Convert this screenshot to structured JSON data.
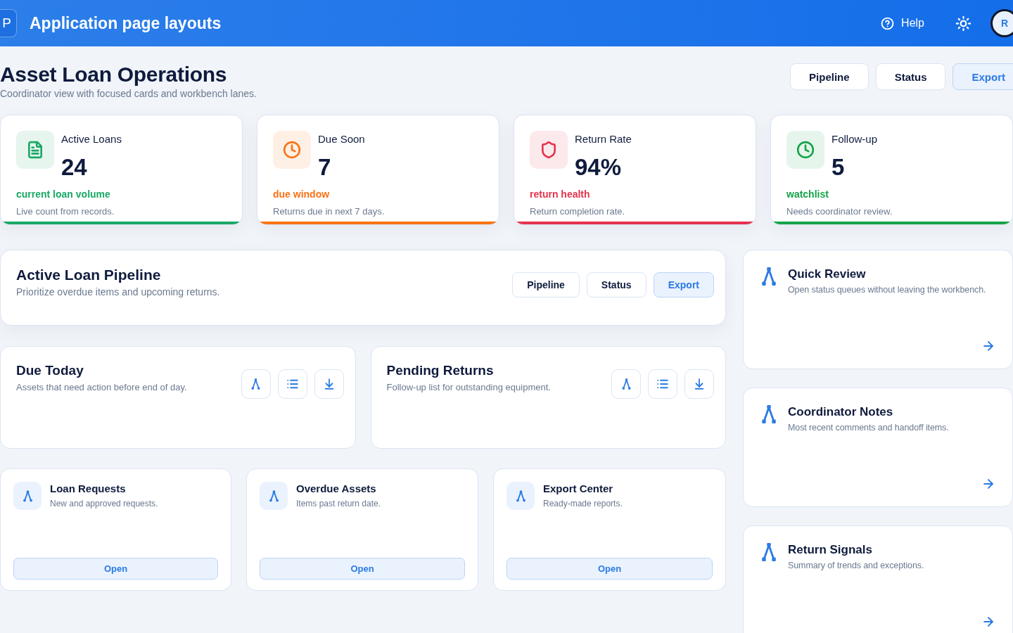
{
  "header": {
    "logo": "P",
    "title": "Application page layouts",
    "help": "Help",
    "avatar": "R"
  },
  "page": {
    "title": "Asset Loan Operations",
    "subtitle": "Coordinator view with focused cards and workbench lanes.",
    "views": [
      {
        "label": "Pipeline",
        "selected": false
      },
      {
        "label": "Status",
        "selected": false
      },
      {
        "label": "Export",
        "selected": true
      }
    ]
  },
  "kpis": [
    {
      "kind": "document",
      "color": "#19a866",
      "label": "Active Loans",
      "value": "24",
      "tag": "current loan volume",
      "note": "Live count from records."
    },
    {
      "kind": "clock",
      "color": "#f97316",
      "label": "Due Soon",
      "value": "7",
      "tag": "due window",
      "note": "Returns due in next 7 days."
    },
    {
      "kind": "shield",
      "color": "#e5334d",
      "label": "Return Rate",
      "value": "94%",
      "tag": "return health",
      "note": "Return completion rate."
    },
    {
      "kind": "clock",
      "color": "#16a34a",
      "label": "Follow-up",
      "value": "5",
      "tag": "watchlist",
      "note": "Needs coordinator review."
    }
  ],
  "pipeline": {
    "title": "Active Loan Pipeline",
    "subtitle": "Prioritize overdue items and upcoming returns.",
    "views": [
      {
        "label": "Pipeline",
        "selected": false
      },
      {
        "label": "Status",
        "selected": false
      },
      {
        "label": "Export",
        "selected": true
      }
    ]
  },
  "lanes": [
    {
      "title": "Due Today",
      "subtitle": "Assets that need action before end of day.",
      "tools": [
        {
          "kind": "branch"
        },
        {
          "kind": "list"
        },
        {
          "kind": "download"
        }
      ]
    },
    {
      "title": "Pending Returns",
      "subtitle": "Follow-up list for outstanding equipment.",
      "tools": [
        {
          "kind": "branch"
        },
        {
          "kind": "list"
        },
        {
          "kind": "download"
        }
      ]
    }
  ],
  "modules": [
    {
      "title": "Loan Requests",
      "subtitle": "New and approved requests.",
      "action": "Open"
    },
    {
      "title": "Overdue Assets",
      "subtitle": "Items past return date.",
      "action": "Open"
    },
    {
      "title": "Export Center",
      "subtitle": "Ready-made reports.",
      "action": "Open"
    }
  ],
  "side_cards": [
    {
      "title": "Quick Review",
      "subtitle": "Open status queues without leaving the workbench."
    },
    {
      "title": "Coordinator Notes",
      "subtitle": "Most recent comments and handoff items."
    },
    {
      "title": "Return Signals",
      "subtitle": "Summary of trends and exceptions."
    }
  ]
}
